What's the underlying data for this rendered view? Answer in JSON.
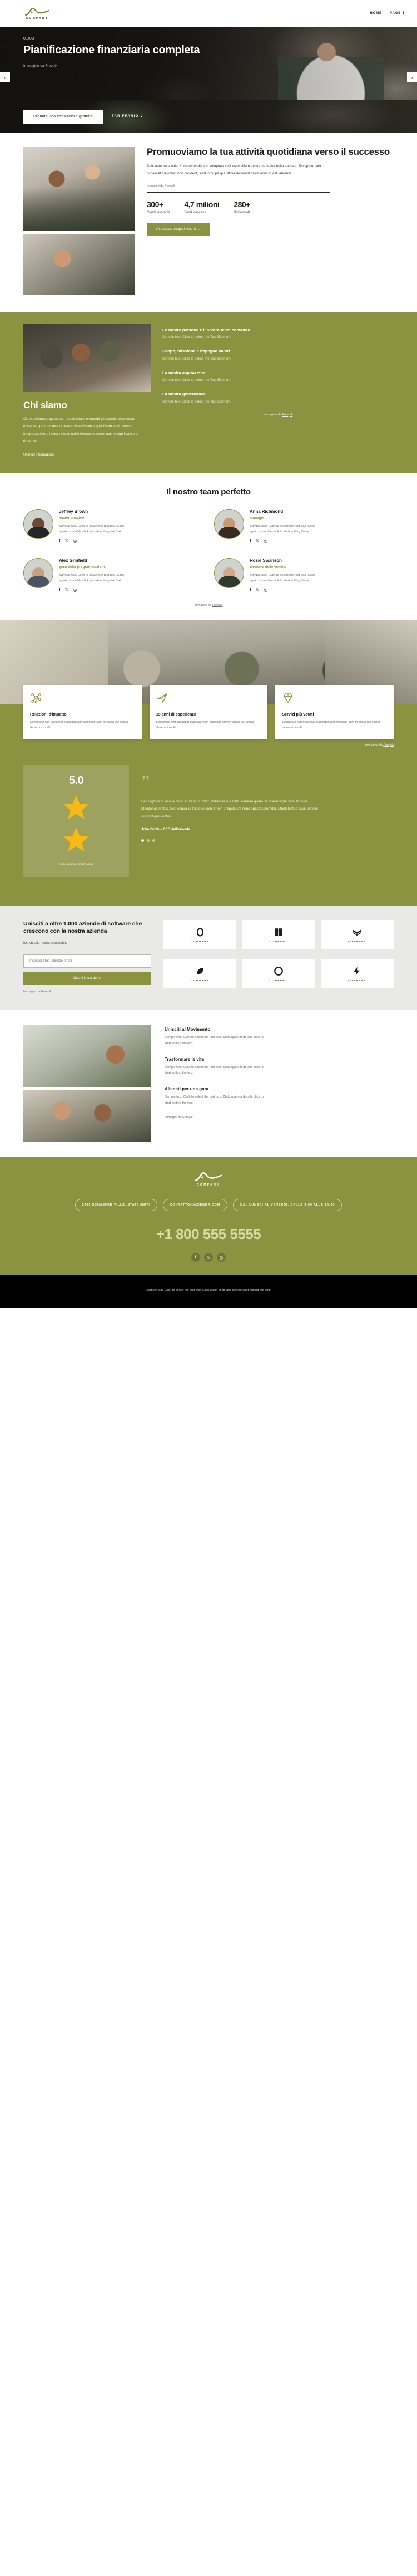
{
  "header": {
    "brand_word": "COMPANY",
    "nav": [
      {
        "label": "HOME"
      },
      {
        "label": "PAGE 1"
      }
    ]
  },
  "hero": {
    "counter": "01/03",
    "title": "Pianificazione finanziaria completa",
    "credit_prefix": "Immagine da ",
    "credit_link": "Freepik",
    "cta_button": "Prenota una consulenza gratuita",
    "cta_link": "TARIFFARIO",
    "prev_icon": "chevron-left-icon",
    "next_icon": "chevron-right-icon"
  },
  "promo": {
    "heading": "Promuoviamo la tua attività quotidiana verso il successo",
    "paragraph": "Duis aute irure dolor in reprehenderit in voluptate velit esse cillum dolore eu fugiat nulla pariatur. Excepteur sint occaecat cupidatat non proident, sunt in culpa qui officia deserunt mollit anim id est laborum.",
    "credit_prefix": "Immagini da ",
    "credit_link": "Freepik",
    "stats": [
      {
        "value": "300+",
        "label": "Giorni lavorativi"
      },
      {
        "value": "4,7 milioni",
        "label": "Fondi concessi"
      },
      {
        "value": "280+",
        "label": "Siti lanciati"
      }
    ],
    "button": "Visualizza progetti recenti  →"
  },
  "about": {
    "heading": "Chi siamo",
    "paragraph": "Ci dedichiamo equamente a soddisfare entrambi gli aspetti della nostra missione: promuovere un team diversificato e qualificato e allo stesso tempo assistere i nostri clienti nell'effettuare trasformazioni significative e durature.",
    "link": "Ulteriori informazioni",
    "items": [
      {
        "title": "Le nostre persone e il nostro team comando",
        "text": "Sample text. Click to select the Text Element."
      },
      {
        "title": "Scopo, missione e impegno valori",
        "text": "Sample text. Click to select the Text Element."
      },
      {
        "title": "La nostra aspirazione",
        "text": "Sample text. Click to select the Text Element."
      },
      {
        "title": "La nostra governance",
        "text": "Sample text. Click to select the Text Element."
      }
    ],
    "credit_prefix": "Immagine da ",
    "credit_link": "Freepik"
  },
  "team": {
    "heading": "Il nostro team perfetto",
    "members": [
      {
        "name": "Jeffrey Brown",
        "role": "leader creativo",
        "desc": "Sample text. Click to select the text box. Click again or double click to start editing the text."
      },
      {
        "name": "Anna Richmond",
        "role": "manager",
        "desc": "Sample text. Click to select the text box. Click again or double click to start editing the text."
      },
      {
        "name": "Alex Grinfield",
        "role": "guru della programmazione",
        "desc": "Sample text. Click to select the text box. Click again or double click to start editing the text."
      },
      {
        "name": "Rosie Swanson",
        "role": "direttore delle vendite",
        "desc": "Sample text. Click to select the text box. Click again or double click to start editing the text."
      }
    ],
    "social": [
      "facebook-icon",
      "x-twitter-icon",
      "instagram-icon"
    ],
    "credit_prefix": "Immagini da ",
    "credit_link": "Freepik"
  },
  "features": {
    "cards": [
      {
        "icon": "network-nodes-icon",
        "title": "Relazioni d'impatto",
        "text": "Excepteur sint occaecat cupidatat non proident, sunt in culpa qui officia deserunt mollit."
      },
      {
        "icon": "paper-plane-icon",
        "title": "15 anni di esperienza",
        "text": "Excepteur sint occaecat cupidatat non proident, sunt in culpa qui officia deserunt mollit."
      },
      {
        "icon": "diamond-icon",
        "title": "Servizi più votati",
        "text": "Excepteur sint occaecat cupidatat non proident, sunt in culpa qui officia deserunt mollit."
      }
    ],
    "credit_prefix": "Immagine da ",
    "credit_link": "Freepik"
  },
  "review": {
    "score": "5.0",
    "stars": 2,
    "leave_link": "Lascia una recensione",
    "quote_glyph": "”",
    "text": "Sed dignissim lacinia nunc. Curabitur tortor. Pellentesque nibh. Aenean quam. In scelerisque sem at dolor. Maecenas mattis. Sed convallis tristique sem. Proin ut ligula vel nunc egestas porttitor. Morbi lectus risus ultrices suscipit quis luctus.",
    "author": "John Smith – CEO dell'azienda",
    "dots": 3,
    "active_dot": 0
  },
  "newsletter": {
    "heading": "Unisciti a oltre 1.000 aziende di software che crescono con la nostra azienda",
    "paragraph": "Iscriviti alla nostra newsletter.",
    "input_placeholder": "Inserisci il tuo indirizzo email",
    "button": "Ottieni la tua demo",
    "credit_prefix": "Immagini da ",
    "credit_link": "Freepik",
    "logos": [
      {
        "icon": "circle-mark-icon",
        "label": "COMPANY"
      },
      {
        "icon": "book-mark-icon",
        "label": "COMPANY"
      },
      {
        "icon": "wave-mark-icon",
        "label": "COMPANY"
      },
      {
        "icon": "leaf-mark-icon",
        "label": "COMPANY"
      },
      {
        "icon": "ring-mark-icon",
        "label": "COMPANY"
      },
      {
        "icon": "bolt-mark-icon",
        "label": "COMPANY"
      }
    ]
  },
  "movement": {
    "items": [
      {
        "title": "Unisciti al Movimento",
        "text": "Sample text. Click to select the text box. Click again or double click to start editing the text."
      },
      {
        "title": "Trasformare le vite",
        "text": "Sample text. Click to select the text box. Click again or double click to start editing the text."
      },
      {
        "title": "Allenati per una gara",
        "text": "Sample text. Click to select the text box. Click again or double click to start editing the text."
      }
    ],
    "credit_prefix": "Immagini da ",
    "credit_link": "Freepik"
  },
  "footer": {
    "brand_word": "COMPANY",
    "pills": [
      {
        "label": "2469 SCHAEFER VILLE, STATI UNITI"
      },
      {
        "label": "CONTATTO@AZIENDA.COM"
      },
      {
        "label": "DAL LUNEDÌ AL VENERDÌ: DALLE 9:00 ALLE 18:00"
      }
    ],
    "phone": "+1 800 555 5555",
    "social": [
      "facebook-icon",
      "x-twitter-icon",
      "instagram-icon"
    ],
    "bottom_text": "Sample text. Click to select the text box. Click again or double click to start editing the text."
  },
  "colors": {
    "olive": "#8b9240",
    "olive_dark": "#6e7539",
    "star": "#f7b916",
    "ink": "#1d1d1b",
    "grey_bg": "#e9e9e7"
  }
}
